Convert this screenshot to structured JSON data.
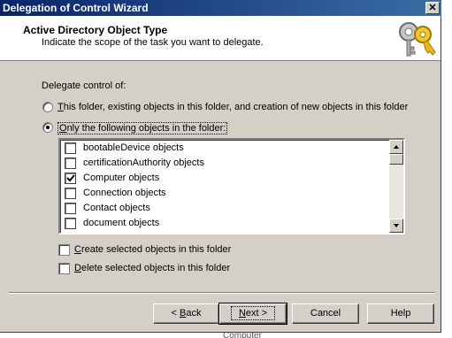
{
  "window": {
    "title": "Delegation of Control Wizard",
    "close_label": "✕"
  },
  "header": {
    "title": "Active Directory Object Type",
    "subtitle": "Indicate the scope of the task you want to delegate."
  },
  "delegate": {
    "label": "Delegate control of:",
    "option_this_folder": {
      "mnemonic": "T",
      "rest": "his folder, existing objects in this folder, and creation of new objects in this folder",
      "selected": false
    },
    "option_only_following": {
      "mnemonic": "O",
      "rest": "nly the following objects in the folder:",
      "selected": true
    }
  },
  "object_list": {
    "items": [
      {
        "label": "bootableDevice objects",
        "checked": false
      },
      {
        "label": "certificationAuthority objects",
        "checked": false
      },
      {
        "label": "Computer objects",
        "checked": true
      },
      {
        "label": "Connection objects",
        "checked": false
      },
      {
        "label": "Contact objects",
        "checked": false
      },
      {
        "label": "document objects",
        "checked": false
      }
    ]
  },
  "create_selected": {
    "mnemonic": "C",
    "rest": "reate selected objects in this folder",
    "checked": false
  },
  "delete_selected": {
    "mnemonic": "D",
    "rest": "elete selected objects in this folder",
    "checked": false
  },
  "buttons": {
    "back": {
      "prefix": "< ",
      "mnemonic": "B",
      "rest": "ack"
    },
    "next": {
      "mnemonic": "N",
      "rest": "ext >"
    },
    "cancel": "Cancel",
    "help": "Help"
  },
  "background_text": "Computer"
}
